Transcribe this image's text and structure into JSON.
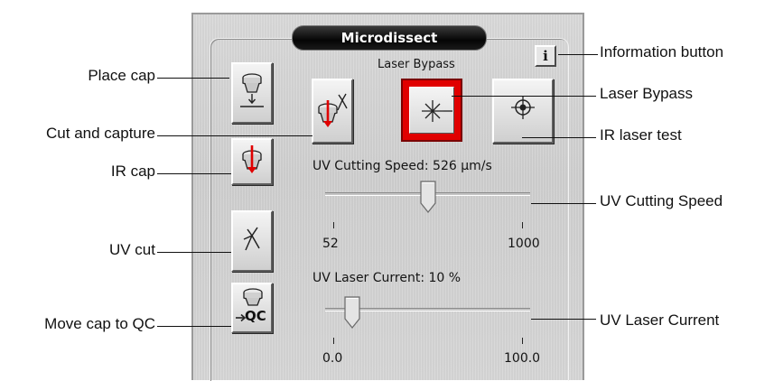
{
  "panel": {
    "title": "Microdissect",
    "info_label": "i",
    "laser_bypass_caption": "Laser Bypass"
  },
  "buttons": {
    "place_cap": "place-cap-icon",
    "ir_cap": "ir-cap-icon",
    "uv_cut": "scissors-icon",
    "move_cap_qc": "move-cap-qc-icon",
    "move_cap_qc_text": "QC",
    "cut_and_capture": "cut-and-capture-icon",
    "laser_bypass": "laser-burst-icon",
    "ir_laser_test": "crosshair-icon",
    "laser_bypass_active_color": "#e00000"
  },
  "sliders": {
    "uv_cutting_speed": {
      "label": "UV Cutting Speed: 526 µm/s",
      "value": 526,
      "min": 52,
      "max": 1000,
      "min_label": "52",
      "max_label": "1000"
    },
    "uv_laser_current": {
      "label": "UV Laser Current: 10 %",
      "value": 10,
      "min": 0,
      "max": 100,
      "min_label": "0.0",
      "max_label": "100.0"
    }
  },
  "callouts": {
    "place_cap": "Place cap",
    "cut_and_capture": "Cut and capture",
    "ir_cap": "IR cap",
    "uv_cut": "UV cut",
    "move_cap_qc": "Move cap to QC",
    "information_button": "Information button",
    "laser_bypass": "Laser Bypass",
    "ir_laser_test": "IR laser test",
    "uv_cutting_speed": "UV Cutting Speed",
    "uv_laser_current": "UV Laser Current"
  }
}
